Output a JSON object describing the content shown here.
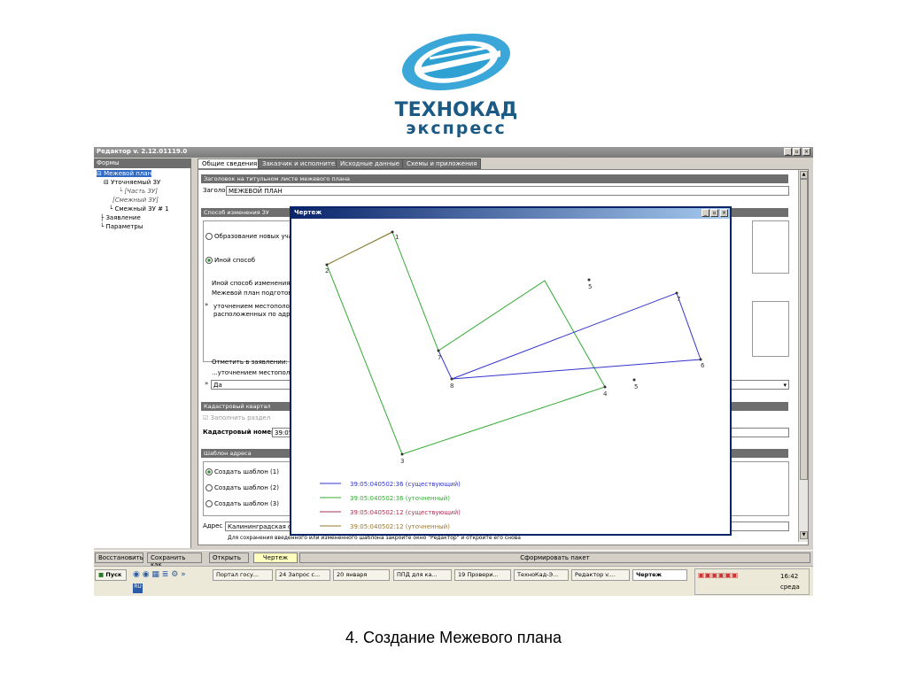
{
  "logo": {
    "line1": "ТЕХНОКАД",
    "line2": "экспресс",
    "color": "#1b5a85"
  },
  "window": {
    "title": "Редактор v. 2.12.01119.0",
    "controls": [
      "_",
      "▫",
      "×"
    ]
  },
  "left": {
    "header": "Формы",
    "items": [
      {
        "label": "⊟ Межевой план",
        "indent": 0,
        "selected": true
      },
      {
        "label": "⊟ Уточняемый ЗУ",
        "indent": 8
      },
      {
        "label": "└ [Часть ЗУ]",
        "indent": 28,
        "italic": true
      },
      {
        "label": "[Смежный ЗУ]",
        "indent": 18,
        "italic": true
      },
      {
        "label": "└ Смежный ЗУ # 1",
        "indent": 14
      },
      {
        "label": "├ Заявление",
        "indent": 4
      },
      {
        "label": "└ Параметры",
        "indent": 4
      }
    ]
  },
  "tabs": [
    "Общие сведения",
    "Заказчик и исполнитель",
    "Исходные данные",
    "Схемы и приложения"
  ],
  "content": {
    "sec1": "Заголовок на титульном листе межевого плана",
    "title_label": "Заголовок",
    "title_value": "МЕЖЕВОЙ ПЛАН",
    "sec2": "Способ изменения ЗУ",
    "radio1": "Образование новых участ",
    "radio2": "Иной способ",
    "text1": "Иной способ изменения ЗУ -",
    "text2": "Межевой план подготовлен",
    "text3": "уточнением местоположе",
    "text4": "расположенных по адресу",
    "text5": "Отметить в заявлении: пр",
    "text6": "...уточнением местоположе",
    "select_value": "Да",
    "sec3": "Кадастровый квартал",
    "fill_section": "Заполнить раздел",
    "cad_label": "Кадастровый номер",
    "cad_value": "39:05",
    "sec4": "Шаблон адреса",
    "tpl": [
      "Создать шаблон (1)",
      "Создать шаблон (2)",
      "Создать шаблон (3)"
    ],
    "addr_label": "Адрес",
    "addr_value": "Калининградская обл",
    "note": "Для сохранения введенного или измененного шаблона закройте окно \"Редактор\" и откройте его снова"
  },
  "bottom": {
    "b1": "Восстановить",
    "b2": "Сохранить как...",
    "b3": "Открыть",
    "b4": "Чертеж",
    "b5": "Сформировать пакет"
  },
  "taskbar": {
    "start": "Пуск",
    "lang": "RU",
    "items": [
      "Портал госу...",
      "24 Запрос с...",
      "20 января",
      "ППД для ка...",
      "19 Провери...",
      "ТехноКад-Э...",
      "Редактор v....",
      "Чертеж"
    ],
    "time": "16:42",
    "day": "среда"
  },
  "dialog": {
    "title": "Чертеж",
    "legend": [
      {
        "label": "39:05:040502:36 (существующий)",
        "color": "#3333cc"
      },
      {
        "label": "39:05:040502:36 (уточненный)",
        "color": "#33aa33"
      },
      {
        "label": "39:05:040502:12 (существующий)",
        "color": "#aa3355"
      },
      {
        "label": "39:05:040502:12 (уточненный)",
        "color": "#997733"
      }
    ],
    "points": [
      "1",
      "2",
      "3",
      "4",
      "5",
      "6",
      "7",
      "8",
      "5",
      "7"
    ]
  },
  "caption": "4. Создание Межевого плана"
}
